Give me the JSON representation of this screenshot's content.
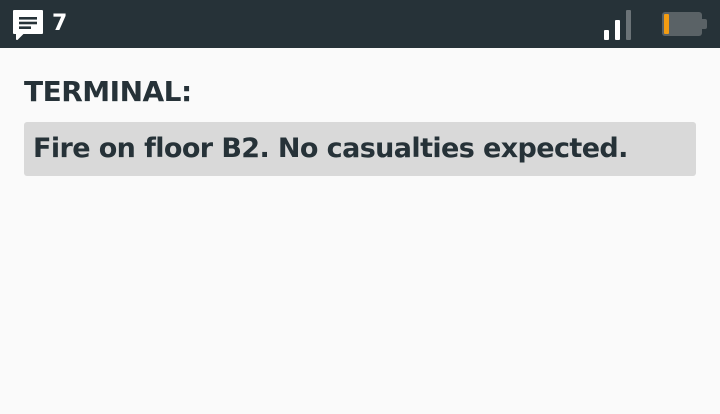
{
  "status_bar": {
    "message_icon": "chat-message-icon",
    "message_count": "7",
    "signal_icon": "signal-strength-icon",
    "signal_bars_active": 2,
    "signal_bars_total": 3,
    "battery_icon": "battery-icon",
    "battery_level": 0.15
  },
  "terminal": {
    "label": "TERMINAL:",
    "message": "Fire on floor B2. No casualties expected."
  },
  "colors": {
    "status_bar_bg": "#263238",
    "page_bg": "#fafafa",
    "message_box_bg": "#d9d9d9",
    "text": "#263238",
    "battery_fill": "#f39c12",
    "signal_active": "#ffffff",
    "signal_inactive": "#6b7377"
  }
}
